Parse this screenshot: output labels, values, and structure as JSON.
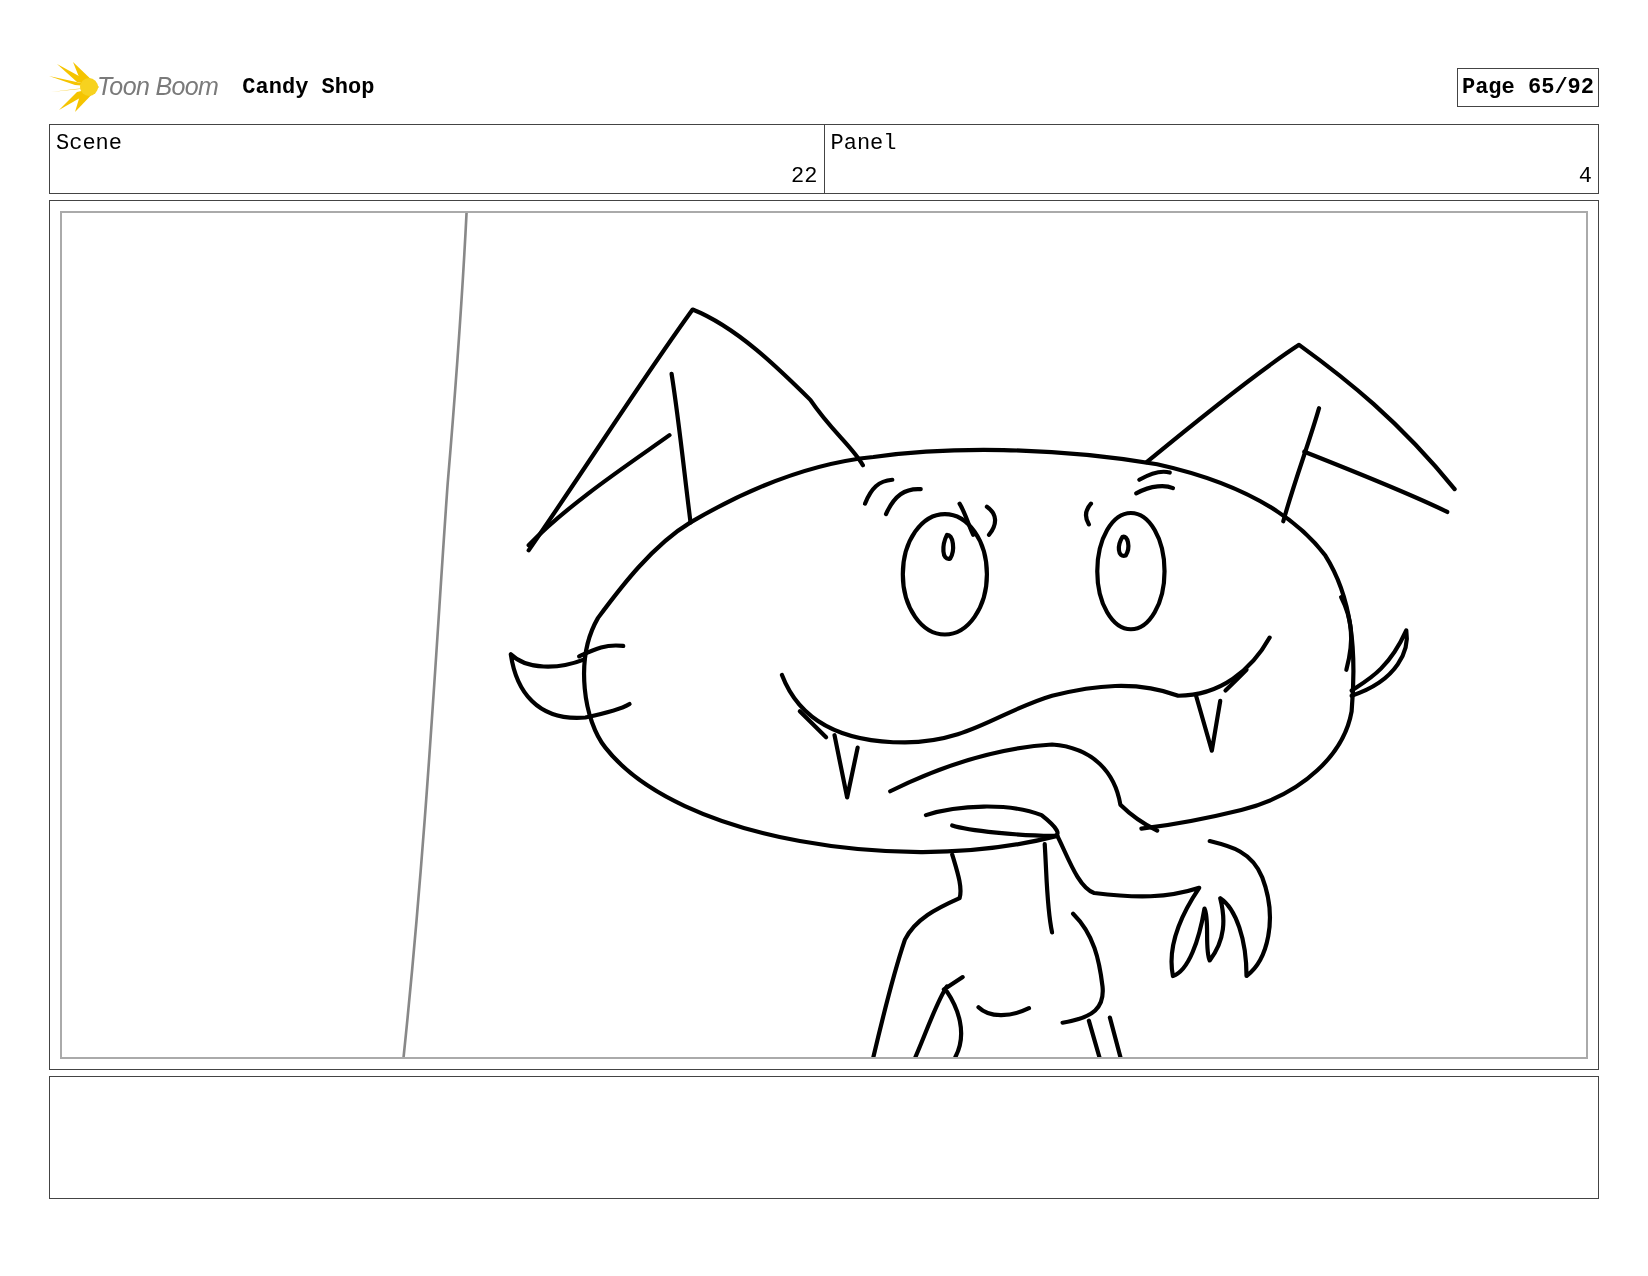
{
  "header": {
    "logo_text": "Toon Boom",
    "title": "Candy Shop",
    "page": "Page 65/92"
  },
  "scene": {
    "label": "Scene",
    "value": "22"
  },
  "panel": {
    "label": "Panel",
    "value": "4"
  }
}
